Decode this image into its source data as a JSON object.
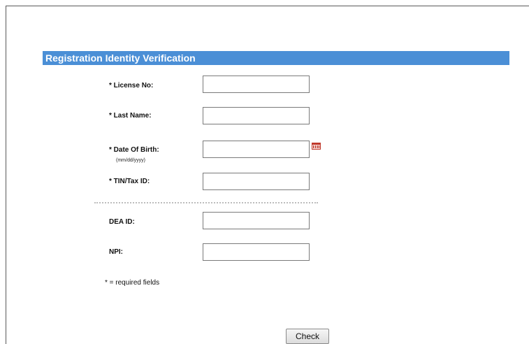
{
  "form": {
    "title": "Registration Identity Verification",
    "fields": [
      {
        "label": "* License No:",
        "value": ""
      },
      {
        "label": "* Last Name:",
        "value": ""
      },
      {
        "label": "* Date Of Birth:",
        "hint": "(mm/dd/yyyy)",
        "value": ""
      },
      {
        "label": "* TIN/Tax ID:",
        "value": ""
      },
      {
        "label": "DEA ID:",
        "value": ""
      },
      {
        "label": "NPI:",
        "value": ""
      }
    ],
    "required_note": "* = required fields",
    "submit_label": "Check",
    "icons": {
      "date_picker": "calendar-icon"
    },
    "colors": {
      "header_bg": "#4b8fd6",
      "header_text": "#ffffff",
      "calendar_accent": "#c0392b"
    }
  }
}
